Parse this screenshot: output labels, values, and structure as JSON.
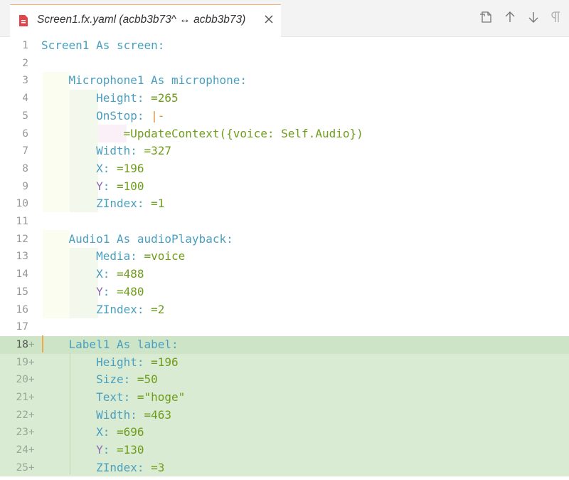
{
  "tab": {
    "title": "Screen1.fx.yaml (acbb3b73^ ↔ acbb3b73)",
    "close_icon": "close-icon",
    "file_icon": "yaml-file-icon"
  },
  "actions": {
    "icons": [
      "open-file-icon",
      "arrow-up-icon",
      "arrow-down-icon",
      "pilcrow-icon"
    ]
  },
  "colors": {
    "added_line_bg": "#d9ebd2",
    "keyword": "#4a9fbf",
    "value": "#6e9c1b",
    "operator": "#e38a3a"
  },
  "lines": [
    {
      "n": "1",
      "marker": "",
      "text": "Screen1 As screen:"
    },
    {
      "n": "2",
      "marker": "",
      "text": ""
    },
    {
      "n": "3",
      "marker": "",
      "text": "    Microphone1 As microphone:"
    },
    {
      "n": "4",
      "marker": "",
      "text": "        Height: =265"
    },
    {
      "n": "5",
      "marker": "",
      "text": "        OnStop: |-"
    },
    {
      "n": "6",
      "marker": "",
      "text": "            =UpdateContext({voice: Self.Audio})"
    },
    {
      "n": "7",
      "marker": "",
      "text": "        Width: =327"
    },
    {
      "n": "8",
      "marker": "",
      "text": "        X: =196"
    },
    {
      "n": "9",
      "marker": "",
      "text": "        Y: =100"
    },
    {
      "n": "10",
      "marker": "",
      "text": "        ZIndex: =1"
    },
    {
      "n": "11",
      "marker": "",
      "text": ""
    },
    {
      "n": "12",
      "marker": "",
      "text": "    Audio1 As audioPlayback:"
    },
    {
      "n": "13",
      "marker": "",
      "text": "        Media: =voice"
    },
    {
      "n": "14",
      "marker": "",
      "text": "        X: =488"
    },
    {
      "n": "15",
      "marker": "",
      "text": "        Y: =480"
    },
    {
      "n": "16",
      "marker": "",
      "text": "        ZIndex: =2"
    },
    {
      "n": "17",
      "marker": "",
      "text": ""
    },
    {
      "n": "18",
      "marker": "+",
      "text": "    Label1 As label:"
    },
    {
      "n": "19",
      "marker": "+",
      "text": "        Height: =196"
    },
    {
      "n": "20",
      "marker": "+",
      "text": "        Size: =50"
    },
    {
      "n": "21",
      "marker": "+",
      "text": "        Text: =\"hoge\""
    },
    {
      "n": "22",
      "marker": "+",
      "text": "        Width: =463"
    },
    {
      "n": "23",
      "marker": "+",
      "text": "        X: =696"
    },
    {
      "n": "24",
      "marker": "+",
      "text": "        Y: =130"
    },
    {
      "n": "25",
      "marker": "+",
      "text": "        ZIndex: =3"
    }
  ]
}
